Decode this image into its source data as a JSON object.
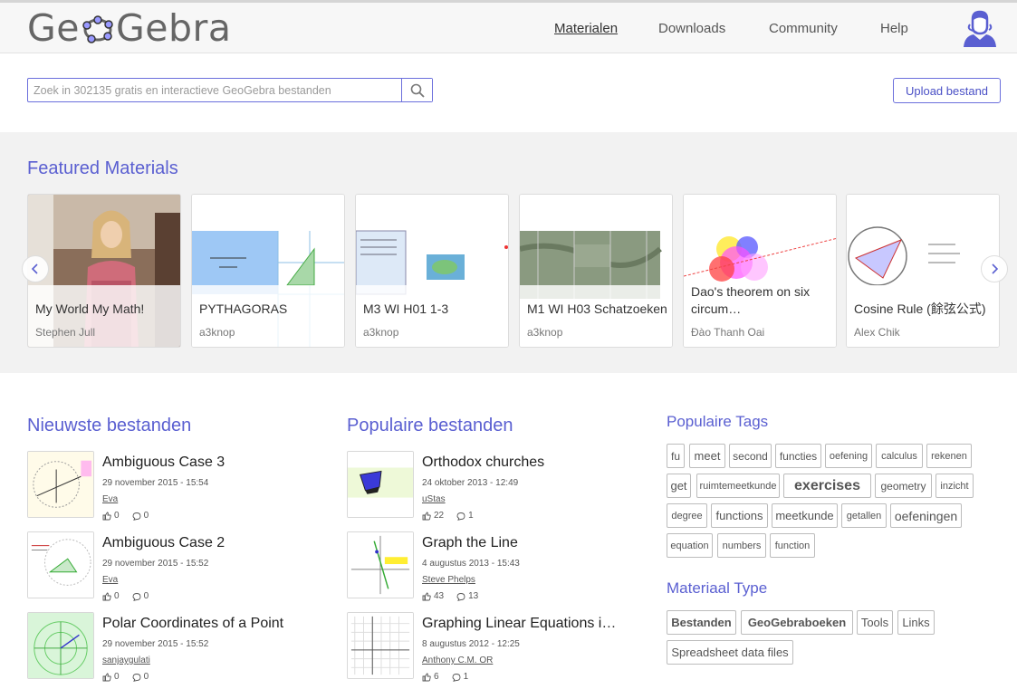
{
  "header": {
    "logo_text_a": "Ge",
    "logo_text_b": "Gebra",
    "nav": [
      "Materialen",
      "Downloads",
      "Community",
      "Help"
    ]
  },
  "search": {
    "placeholder": "Zoek in 302135 gratis en interactieve GeoGebra bestanden",
    "value": ""
  },
  "upload_label": "Upload bestand",
  "featured": {
    "title": "Featured Materials",
    "cards": [
      {
        "title": "My World My Math!",
        "author": "Stephen Jull"
      },
      {
        "title": "PYTHAGORAS",
        "author": "a3knop"
      },
      {
        "title": "M3 WI H01 1-3",
        "author": "a3knop"
      },
      {
        "title": "M1 WI H03 Schatzoeken",
        "author": "a3knop"
      },
      {
        "title": "Dao's theorem on six circum…",
        "author": "Đào Thanh Oai"
      },
      {
        "title": "Cosine Rule (餘弦公式)",
        "author": "Alex Chik"
      }
    ]
  },
  "newest": {
    "title": "Nieuwste bestanden",
    "items": [
      {
        "title": "Ambiguous Case 3",
        "date": "29 november 2015 - 15:54",
        "author": "Eva",
        "likes": "0",
        "comments": "0"
      },
      {
        "title": "Ambiguous Case 2",
        "date": "29 november 2015 - 15:52",
        "author": "Eva",
        "likes": "0",
        "comments": "0"
      },
      {
        "title": "Polar Coordinates of a Point",
        "date": "29 november 2015 - 15:52",
        "author": "sanjaygulati",
        "likes": "0",
        "comments": "0"
      }
    ]
  },
  "popular": {
    "title": "Populaire bestanden",
    "items": [
      {
        "title": "Orthodox churches",
        "date": "24 oktober 2013 - 12:49",
        "author": "uStas",
        "likes": "22",
        "comments": "1"
      },
      {
        "title": "Graph the Line",
        "date": "4 augustus 2013 - 15:43",
        "author": "Steve Phelps",
        "likes": "43",
        "comments": "13"
      },
      {
        "title": "Graphing Linear Equations i…",
        "date": "8 augustus 2012 - 12:25",
        "author": "Anthony C.M. OR",
        "likes": "6",
        "comments": "1"
      }
    ]
  },
  "tags": {
    "title": "Populaire Tags",
    "items": [
      "fu",
      "meet",
      "second",
      "functies",
      "oefening",
      "calculus",
      "rekenen",
      "get",
      "ruimtemeetkunde",
      "exercises",
      "geometry",
      "inzicht",
      "degree",
      "functions",
      "meetkunde",
      "getallen",
      "oefeningen",
      "equation",
      "numbers",
      "function"
    ]
  },
  "material_type": {
    "title": "Materiaal Type",
    "items": [
      "Bestanden",
      "GeoGebraboeken",
      "Tools",
      "Links",
      "Spreadsheet data files"
    ]
  },
  "colors": {
    "accent": "#5a5fd1",
    "border": "#6b6fdc"
  },
  "icons": [
    "user-avatar-icon",
    "search-icon",
    "chevron-left-icon",
    "chevron-right-icon",
    "thumbs-up-icon",
    "comment-icon"
  ]
}
